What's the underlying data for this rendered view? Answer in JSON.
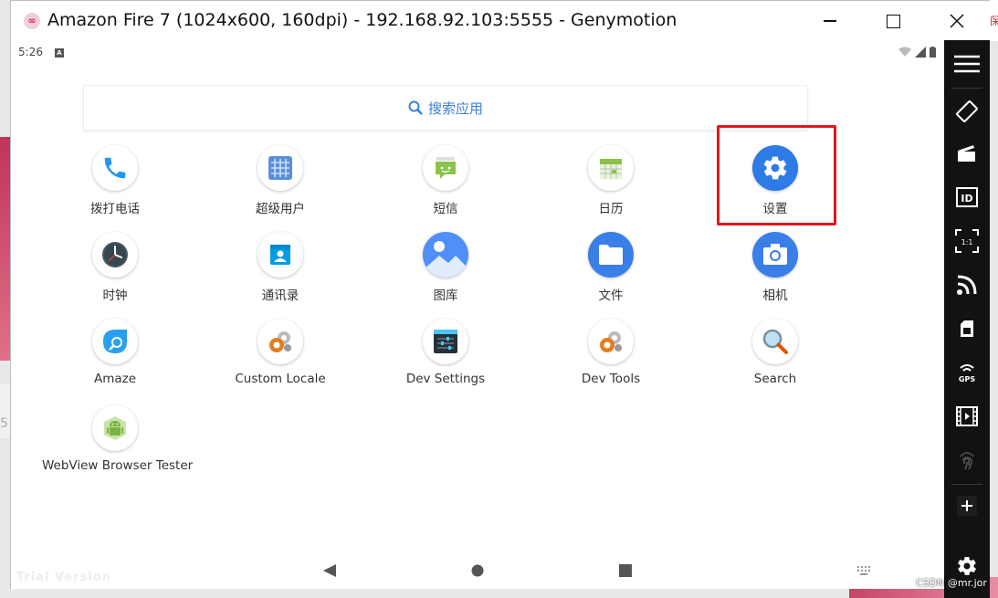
{
  "window": {
    "title": "Amazon Fire 7 (1024x600, 160dpi) - 192.168.92.103:5555 - Genymotion"
  },
  "status": {
    "time": "5:26",
    "notification_letter": "A"
  },
  "search": {
    "label": "搜索应用"
  },
  "apps": [
    {
      "label": "拨打电话",
      "icon": "phone-icon"
    },
    {
      "label": "超级用户",
      "icon": "grid-icon"
    },
    {
      "label": "短信",
      "icon": "message-icon"
    },
    {
      "label": "日历",
      "icon": "calendar-icon"
    },
    {
      "label": "设置",
      "icon": "gear-icon"
    },
    {
      "label": "时钟",
      "icon": "clock-icon"
    },
    {
      "label": "通讯录",
      "icon": "contacts-icon"
    },
    {
      "label": "图库",
      "icon": "gallery-icon"
    },
    {
      "label": "文件",
      "icon": "folder-icon"
    },
    {
      "label": "相机",
      "icon": "camera-icon"
    },
    {
      "label": "Amaze",
      "icon": "amaze-icon"
    },
    {
      "label": "Custom Locale",
      "icon": "settings-cog-icon"
    },
    {
      "label": "Dev Settings",
      "icon": "dev-settings-icon"
    },
    {
      "label": "Dev Tools",
      "icon": "settings-cog-icon"
    },
    {
      "label": "Search",
      "icon": "magnifier-icon"
    },
    {
      "label": "WebView Browser Tester",
      "icon": "android-icon"
    }
  ],
  "overlay": {
    "trial": "Trial Version"
  },
  "watermark": "CSDN @mr.jor",
  "background": {
    "left_char": "5",
    "top_right_char": "保"
  },
  "colors": {
    "highlight": "#e8131b",
    "accent_blue": "#3c7fdc",
    "toolbar_bg": "#121212"
  }
}
